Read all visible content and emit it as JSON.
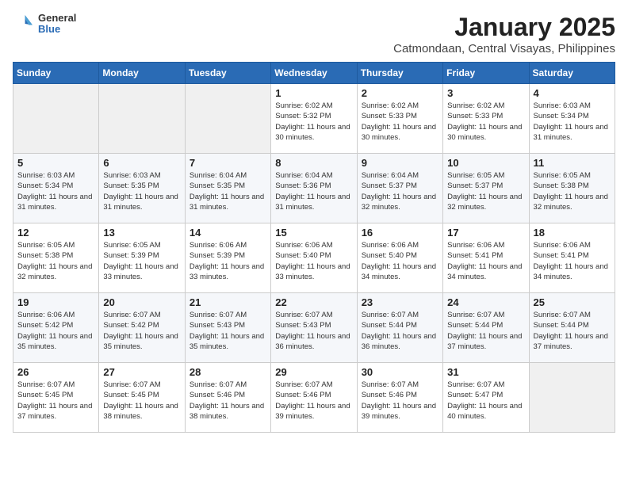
{
  "logo": {
    "general": "General",
    "blue": "Blue"
  },
  "header": {
    "month_year": "January 2025",
    "location": "Catmondaan, Central Visayas, Philippines"
  },
  "weekdays": [
    "Sunday",
    "Monday",
    "Tuesday",
    "Wednesday",
    "Thursday",
    "Friday",
    "Saturday"
  ],
  "weeks": [
    [
      {
        "day": "",
        "sunrise": "",
        "sunset": "",
        "daylight": ""
      },
      {
        "day": "",
        "sunrise": "",
        "sunset": "",
        "daylight": ""
      },
      {
        "day": "",
        "sunrise": "",
        "sunset": "",
        "daylight": ""
      },
      {
        "day": "1",
        "sunrise": "Sunrise: 6:02 AM",
        "sunset": "Sunset: 5:32 PM",
        "daylight": "Daylight: 11 hours and 30 minutes."
      },
      {
        "day": "2",
        "sunrise": "Sunrise: 6:02 AM",
        "sunset": "Sunset: 5:33 PM",
        "daylight": "Daylight: 11 hours and 30 minutes."
      },
      {
        "day": "3",
        "sunrise": "Sunrise: 6:02 AM",
        "sunset": "Sunset: 5:33 PM",
        "daylight": "Daylight: 11 hours and 30 minutes."
      },
      {
        "day": "4",
        "sunrise": "Sunrise: 6:03 AM",
        "sunset": "Sunset: 5:34 PM",
        "daylight": "Daylight: 11 hours and 31 minutes."
      }
    ],
    [
      {
        "day": "5",
        "sunrise": "Sunrise: 6:03 AM",
        "sunset": "Sunset: 5:34 PM",
        "daylight": "Daylight: 11 hours and 31 minutes."
      },
      {
        "day": "6",
        "sunrise": "Sunrise: 6:03 AM",
        "sunset": "Sunset: 5:35 PM",
        "daylight": "Daylight: 11 hours and 31 minutes."
      },
      {
        "day": "7",
        "sunrise": "Sunrise: 6:04 AM",
        "sunset": "Sunset: 5:35 PM",
        "daylight": "Daylight: 11 hours and 31 minutes."
      },
      {
        "day": "8",
        "sunrise": "Sunrise: 6:04 AM",
        "sunset": "Sunset: 5:36 PM",
        "daylight": "Daylight: 11 hours and 31 minutes."
      },
      {
        "day": "9",
        "sunrise": "Sunrise: 6:04 AM",
        "sunset": "Sunset: 5:37 PM",
        "daylight": "Daylight: 11 hours and 32 minutes."
      },
      {
        "day": "10",
        "sunrise": "Sunrise: 6:05 AM",
        "sunset": "Sunset: 5:37 PM",
        "daylight": "Daylight: 11 hours and 32 minutes."
      },
      {
        "day": "11",
        "sunrise": "Sunrise: 6:05 AM",
        "sunset": "Sunset: 5:38 PM",
        "daylight": "Daylight: 11 hours and 32 minutes."
      }
    ],
    [
      {
        "day": "12",
        "sunrise": "Sunrise: 6:05 AM",
        "sunset": "Sunset: 5:38 PM",
        "daylight": "Daylight: 11 hours and 32 minutes."
      },
      {
        "day": "13",
        "sunrise": "Sunrise: 6:05 AM",
        "sunset": "Sunset: 5:39 PM",
        "daylight": "Daylight: 11 hours and 33 minutes."
      },
      {
        "day": "14",
        "sunrise": "Sunrise: 6:06 AM",
        "sunset": "Sunset: 5:39 PM",
        "daylight": "Daylight: 11 hours and 33 minutes."
      },
      {
        "day": "15",
        "sunrise": "Sunrise: 6:06 AM",
        "sunset": "Sunset: 5:40 PM",
        "daylight": "Daylight: 11 hours and 33 minutes."
      },
      {
        "day": "16",
        "sunrise": "Sunrise: 6:06 AM",
        "sunset": "Sunset: 5:40 PM",
        "daylight": "Daylight: 11 hours and 34 minutes."
      },
      {
        "day": "17",
        "sunrise": "Sunrise: 6:06 AM",
        "sunset": "Sunset: 5:41 PM",
        "daylight": "Daylight: 11 hours and 34 minutes."
      },
      {
        "day": "18",
        "sunrise": "Sunrise: 6:06 AM",
        "sunset": "Sunset: 5:41 PM",
        "daylight": "Daylight: 11 hours and 34 minutes."
      }
    ],
    [
      {
        "day": "19",
        "sunrise": "Sunrise: 6:06 AM",
        "sunset": "Sunset: 5:42 PM",
        "daylight": "Daylight: 11 hours and 35 minutes."
      },
      {
        "day": "20",
        "sunrise": "Sunrise: 6:07 AM",
        "sunset": "Sunset: 5:42 PM",
        "daylight": "Daylight: 11 hours and 35 minutes."
      },
      {
        "day": "21",
        "sunrise": "Sunrise: 6:07 AM",
        "sunset": "Sunset: 5:43 PM",
        "daylight": "Daylight: 11 hours and 35 minutes."
      },
      {
        "day": "22",
        "sunrise": "Sunrise: 6:07 AM",
        "sunset": "Sunset: 5:43 PM",
        "daylight": "Daylight: 11 hours and 36 minutes."
      },
      {
        "day": "23",
        "sunrise": "Sunrise: 6:07 AM",
        "sunset": "Sunset: 5:44 PM",
        "daylight": "Daylight: 11 hours and 36 minutes."
      },
      {
        "day": "24",
        "sunrise": "Sunrise: 6:07 AM",
        "sunset": "Sunset: 5:44 PM",
        "daylight": "Daylight: 11 hours and 37 minutes."
      },
      {
        "day": "25",
        "sunrise": "Sunrise: 6:07 AM",
        "sunset": "Sunset: 5:44 PM",
        "daylight": "Daylight: 11 hours and 37 minutes."
      }
    ],
    [
      {
        "day": "26",
        "sunrise": "Sunrise: 6:07 AM",
        "sunset": "Sunset: 5:45 PM",
        "daylight": "Daylight: 11 hours and 37 minutes."
      },
      {
        "day": "27",
        "sunrise": "Sunrise: 6:07 AM",
        "sunset": "Sunset: 5:45 PM",
        "daylight": "Daylight: 11 hours and 38 minutes."
      },
      {
        "day": "28",
        "sunrise": "Sunrise: 6:07 AM",
        "sunset": "Sunset: 5:46 PM",
        "daylight": "Daylight: 11 hours and 38 minutes."
      },
      {
        "day": "29",
        "sunrise": "Sunrise: 6:07 AM",
        "sunset": "Sunset: 5:46 PM",
        "daylight": "Daylight: 11 hours and 39 minutes."
      },
      {
        "day": "30",
        "sunrise": "Sunrise: 6:07 AM",
        "sunset": "Sunset: 5:46 PM",
        "daylight": "Daylight: 11 hours and 39 minutes."
      },
      {
        "day": "31",
        "sunrise": "Sunrise: 6:07 AM",
        "sunset": "Sunset: 5:47 PM",
        "daylight": "Daylight: 11 hours and 40 minutes."
      },
      {
        "day": "",
        "sunrise": "",
        "sunset": "",
        "daylight": ""
      }
    ]
  ]
}
